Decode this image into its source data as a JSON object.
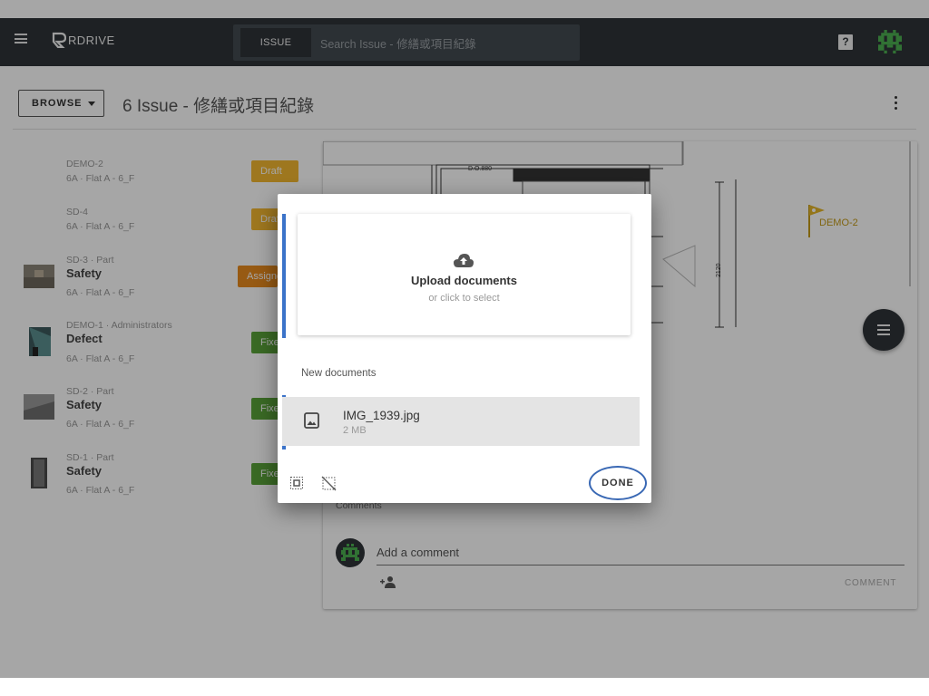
{
  "app": {
    "logo_text": "RDRIVE",
    "search_chip": "ISSUE",
    "search_placeholder": "Search Issue - 修繕或項目紀錄"
  },
  "page": {
    "browse_label": "BROWSE",
    "title": "6 Issue - 修繕或項目紀錄"
  },
  "issues": [
    {
      "line1": "DEMO-2",
      "line2": "",
      "line3": "6A · Flat A - 6_F",
      "badge": "Draft",
      "badge_color": "#f3b730",
      "thumb": "none"
    },
    {
      "line1": "SD-4",
      "line2": "",
      "line3": "6A · Flat A - 6_F",
      "badge": "Draft",
      "badge_color": "#f3b730",
      "thumb": "none"
    },
    {
      "line1": "SD-3 · Part",
      "line2": "Safety",
      "line3": "6A · Flat A - 6_F",
      "badge": "Assigned",
      "badge_color": "#e98a1e",
      "thumb": "photo-wall"
    },
    {
      "line1": "DEMO-1 · Administrators",
      "line2": "Defect",
      "line3": "6A · Flat A - 6_F",
      "badge": "Fixed",
      "badge_color": "#5aa33a",
      "thumb": "photo-teal"
    },
    {
      "line1": "SD-2 · Part",
      "line2": "Safety",
      "line3": "6A · Flat A - 6_F",
      "badge": "Fixed",
      "badge_color": "#5aa33a",
      "thumb": "photo-floor"
    },
    {
      "line1": "SD-1 · Part",
      "line2": "Safety",
      "line3": "6A · Flat A - 6_F",
      "badge": "Fixed",
      "badge_color": "#5aa33a",
      "thumb": "photo-door"
    }
  ],
  "detail": {
    "flag_label": "DEMO-2",
    "drawing_label_do": "D.O.880",
    "drawing_dim": "2120",
    "comments_label": "Comments",
    "comment_placeholder": "Add a comment",
    "comment_button": "COMMENT"
  },
  "modal": {
    "upload_title": "Upload documents",
    "upload_subtitle": "or click to select",
    "section_label": "New documents",
    "document": {
      "name": "IMG_1939.jpg",
      "size": "2 MB"
    },
    "done_label": "DONE"
  },
  "colors": {
    "topbar": "#2f3438",
    "accent_blue": "#3b73c9",
    "draft": "#f3b730",
    "assigned": "#e98a1e",
    "fixed": "#5aa33a"
  }
}
